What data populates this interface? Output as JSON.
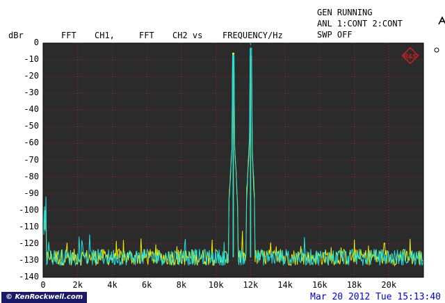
{
  "header": {
    "status_line1": "GEN RUNNING",
    "status_line2": "ANL 1:CONT 2:CONT",
    "status_line3": "SWP OFF",
    "unit": "dBr",
    "fft1": "FFT",
    "ch1": "CH1,",
    "fft2": "FFT",
    "ch2": "CH2 vs",
    "freq": "FREQUENCY/Hz"
  },
  "footer": {
    "credit": "© KenRockwell.com",
    "timestamp": "Mar 20 2012 Tue 15:13:40"
  },
  "colors": {
    "plot_bg": "#2b2b2b",
    "grid": "#b03030",
    "ch1": "#f0f000",
    "ch2": "#20e0e0",
    "logo": "#cc2020"
  },
  "chart_data": {
    "type": "line",
    "title": "",
    "xlabel": "FREQUENCY/Hz",
    "ylabel": "dBr",
    "xlim": [
      0,
      22000
    ],
    "ylim": [
      -140,
      0
    ],
    "x_ticks": [
      "0",
      "2k",
      "4k",
      "6k",
      "8k",
      "10k",
      "12k",
      "14k",
      "16k",
      "18k",
      "20k"
    ],
    "y_ticks": [
      "0",
      "-10",
      "-20",
      "-30",
      "-40",
      "-50",
      "-60",
      "-70",
      "-80",
      "-90",
      "-100",
      "-110",
      "-120",
      "-130",
      "-140"
    ],
    "grid": true,
    "noise_floor_db": -128,
    "series": [
      {
        "color_key": "ch1",
        "peaks": [
          {
            "x": 11000,
            "y": -6
          },
          {
            "x": 12000,
            "y": -8
          }
        ]
      },
      {
        "color_key": "ch2",
        "peaks": [
          {
            "x": 11000,
            "y": -7
          },
          {
            "x": 12000,
            "y": -3
          }
        ]
      }
    ]
  }
}
